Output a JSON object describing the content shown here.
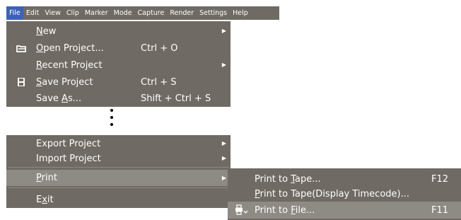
{
  "menubar": {
    "items": [
      "File",
      "Edit",
      "View",
      "Clip",
      "Marker",
      "Mode",
      "Capture",
      "Render",
      "Settings",
      "Help"
    ]
  },
  "file_menu": {
    "items": [
      {
        "label_pre": "",
        "label_u": "N",
        "label_post": "ew",
        "shortcut": "",
        "submenu": true,
        "icon": ""
      },
      {
        "label_pre": "",
        "label_u": "O",
        "label_post": "pen Project...",
        "shortcut": "Ctrl + O",
        "submenu": false,
        "icon": "open-folder-icon"
      },
      {
        "label_pre": "",
        "label_u": "R",
        "label_post": "ecent Project",
        "shortcut": "",
        "submenu": true,
        "icon": ""
      },
      {
        "label_pre": "",
        "label_u": "S",
        "label_post": "ave Project",
        "shortcut": "Ctrl + S",
        "submenu": false,
        "icon": "floppy-disk-icon"
      },
      {
        "label_pre": "Save ",
        "label_u": "A",
        "label_post": "s...",
        "shortcut": "Shift + Ctrl + S",
        "submenu": false,
        "icon": ""
      }
    ],
    "lower_items": [
      {
        "label": "Export Project",
        "submenu": true
      },
      {
        "label": "Import Project",
        "submenu": true
      }
    ],
    "print": {
      "label_u": "P",
      "label_post": "rint",
      "submenu": true
    },
    "exit": {
      "label_pre": "E",
      "label_u": "x",
      "label_post": "it"
    }
  },
  "print_submenu": {
    "items": [
      {
        "label_pre": "Print to ",
        "label_u": "T",
        "label_post": "ape...",
        "shortcut": "F12"
      },
      {
        "label_pre": "",
        "label_u": "P",
        "label_post": "rint to Tape(Display Timecode)...",
        "shortcut": ""
      },
      {
        "label_pre": "Print to ",
        "label_u": "F",
        "label_post": "ile...",
        "shortcut": "F11",
        "icon": "print-to-file-icon"
      }
    ]
  }
}
